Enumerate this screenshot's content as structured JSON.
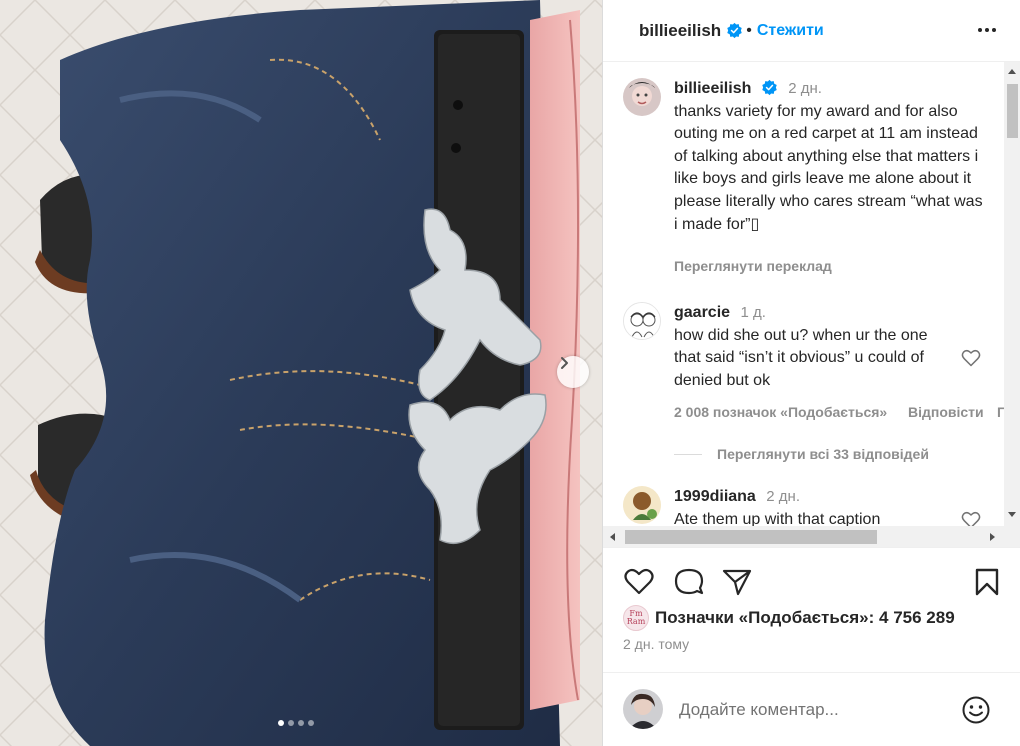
{
  "post": {
    "author": "billieeilish",
    "verified": true,
    "follow_label": "Стежити",
    "more_icon": "more-horizontal-icon",
    "carousel": {
      "count": 4,
      "active": 1
    }
  },
  "caption": {
    "username": "billieeilish",
    "time": "2 дн.",
    "text": "thanks variety for my award and for also outing me on a red carpet at 11 am instead of talking about anything else that matters i like boys and girls leave me alone about it please literally who cares stream “what was i made for”",
    "trailing_glyph": "▯",
    "translate_label": "Переглянути переклад"
  },
  "comments": [
    {
      "username": "gaarcie",
      "time": "1 д.",
      "text": "how did she out u? when ur the one that said “isn’t it obvious” u could of denied but ok",
      "likes_label": "2 008 позначок «Подобається»",
      "reply_label": "Відповісти",
      "overflow_label": "П",
      "view_replies_label": "Переглянути всі 33 відповідей"
    },
    {
      "username": "1999diiana",
      "time": "2 дн.",
      "text": "Ate them up with that caption"
    }
  ],
  "footer": {
    "likes_text": "Позначки «Подобається»: 4 756 289",
    "liker_avatar_text": "Fm\nRam",
    "posted_time": "2 дн. тому",
    "comment_placeholder": "Додайте коментар..."
  },
  "colors": {
    "accent": "#0095f6",
    "text": "#262626",
    "secondary": "#8e8e8e",
    "border": "#dbdbdb"
  }
}
